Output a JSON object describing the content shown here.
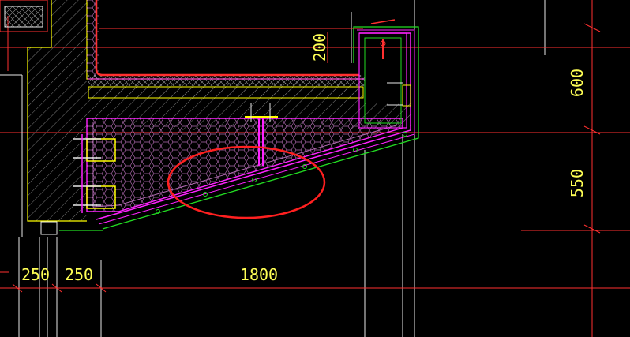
{
  "colors": {
    "background": "#000000",
    "concrete_outline": "#ffff00",
    "hatch": "#7a7a7a",
    "insulation": "#b06ab0",
    "cladding": "#ff22ff",
    "finish_line": "#22dd22",
    "red_line": "#ff3030",
    "dimension_text": "#ffff55",
    "dimension_line": "#ff3030",
    "white_line": "#e8e8e8",
    "bracket": "#ffff00",
    "annotation_ellipse": "#ff2020"
  },
  "dimensions": {
    "top_200": "200",
    "right_600": "600",
    "right_550": "550",
    "bottom_250_a": "250",
    "bottom_250_b": "250",
    "bottom_1800": "1800"
  },
  "annotation": {
    "shape": "ellipse",
    "meaning": "highlighted sloped soffit joint"
  }
}
